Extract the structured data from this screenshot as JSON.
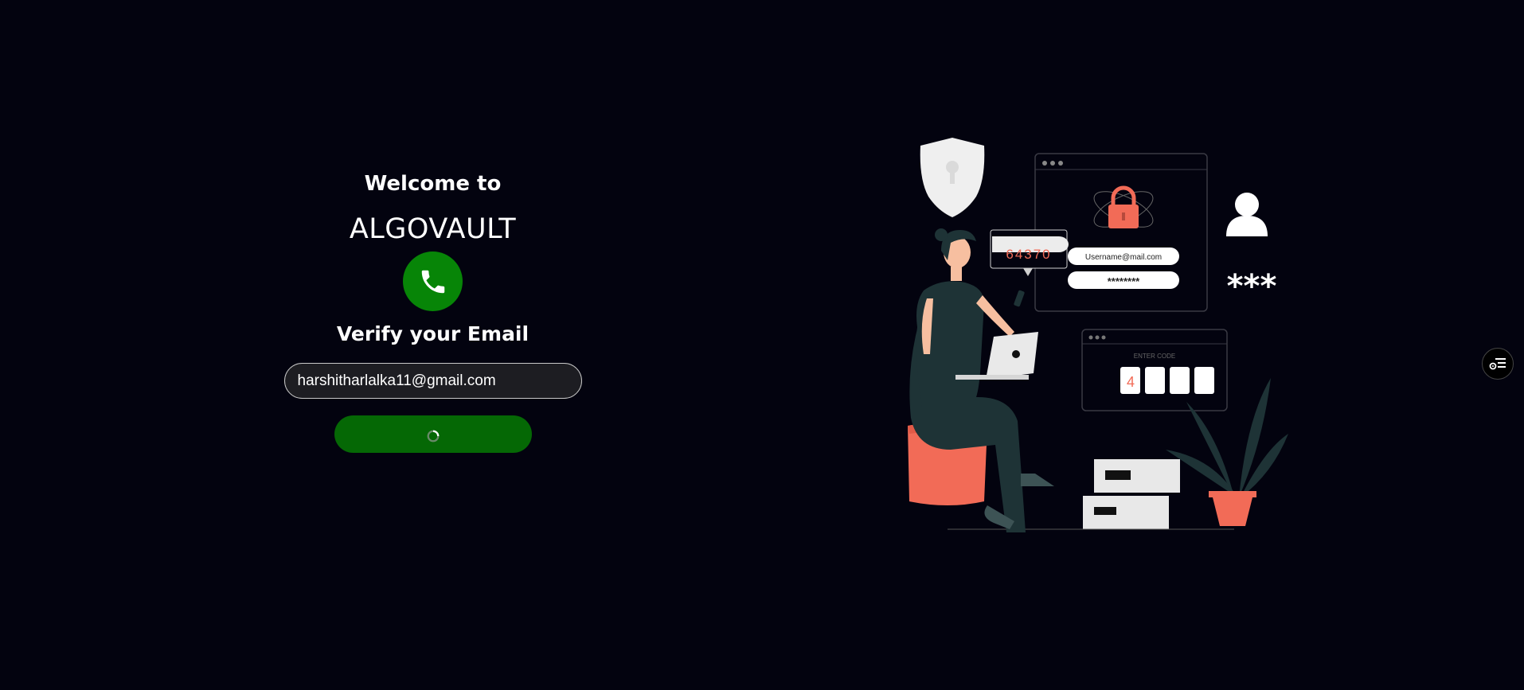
{
  "header": {
    "welcome_text": "Welcome to",
    "brand_name": "ALGOVAULT"
  },
  "icons": {
    "phone": "phone-icon",
    "spinner": "loading-spinner-icon",
    "menu": "settings-list-icon"
  },
  "form": {
    "title": "Verify your Email",
    "email_value": "harshitharlalka11@gmail.com",
    "submit_state": "loading"
  },
  "illustration": {
    "otp_code": "64370",
    "username_field": "Username@mail.com",
    "password_field": "********",
    "masked_password": "***",
    "enter_code_label": "ENTER CODE",
    "code_digit": "4"
  },
  "colors": {
    "background": "#03030f",
    "accent_green": "#078507",
    "button_green": "#056805",
    "coral": "#f26b57"
  }
}
